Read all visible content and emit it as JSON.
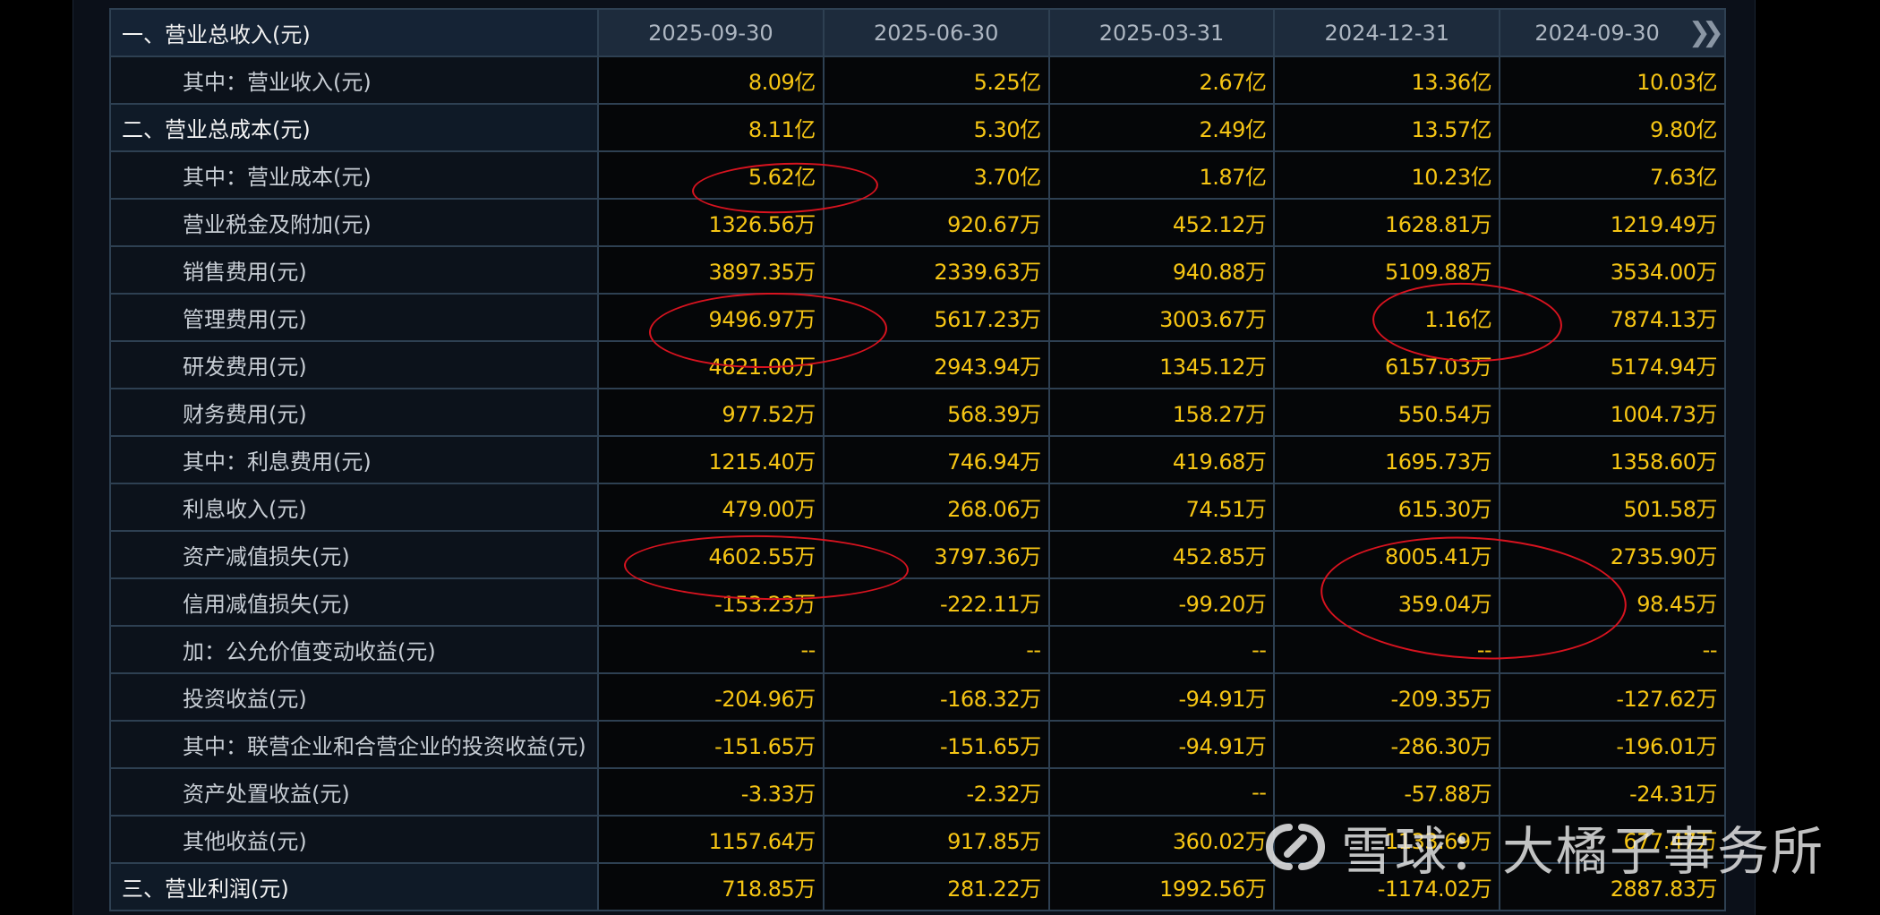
{
  "table": {
    "header_label": "一、营业总收入(元)",
    "dates": [
      "2025-09-30",
      "2025-06-30",
      "2025-03-31",
      "2024-12-31",
      "2024-09-30"
    ],
    "more_icon": "double-chevron-right-icon",
    "rows": [
      {
        "label": "其中：营业收入(元)",
        "indent": "sub",
        "values": [
          "8.09亿",
          "5.25亿",
          "2.67亿",
          "13.36亿",
          "10.03亿"
        ]
      },
      {
        "label": "二、营业总成本(元)",
        "indent": "top",
        "values": [
          "8.11亿",
          "5.30亿",
          "2.49亿",
          "13.57亿",
          "9.80亿"
        ]
      },
      {
        "label": "其中：营业成本(元)",
        "indent": "sub",
        "values": [
          "5.62亿",
          "3.70亿",
          "1.87亿",
          "10.23亿",
          "7.63亿"
        ]
      },
      {
        "label": "营业税金及附加(元)",
        "indent": "sub",
        "values": [
          "1326.56万",
          "920.67万",
          "452.12万",
          "1628.81万",
          "1219.49万"
        ]
      },
      {
        "label": "销售费用(元)",
        "indent": "sub",
        "values": [
          "3897.35万",
          "2339.63万",
          "940.88万",
          "5109.88万",
          "3534.00万"
        ]
      },
      {
        "label": "管理费用(元)",
        "indent": "sub",
        "values": [
          "9496.97万",
          "5617.23万",
          "3003.67万",
          "1.16亿",
          "7874.13万"
        ]
      },
      {
        "label": "研发费用(元)",
        "indent": "sub",
        "values": [
          "4821.00万",
          "2943.94万",
          "1345.12万",
          "6157.03万",
          "5174.94万"
        ]
      },
      {
        "label": "财务费用(元)",
        "indent": "sub",
        "values": [
          "977.52万",
          "568.39万",
          "158.27万",
          "550.54万",
          "1004.73万"
        ]
      },
      {
        "label": "其中：利息费用(元)",
        "indent": "sub",
        "values": [
          "1215.40万",
          "746.94万",
          "419.68万",
          "1695.73万",
          "1358.60万"
        ]
      },
      {
        "label": "利息收入(元)",
        "indent": "sub",
        "values": [
          "479.00万",
          "268.06万",
          "74.51万",
          "615.30万",
          "501.58万"
        ]
      },
      {
        "label": "资产减值损失(元)",
        "indent": "sub",
        "values": [
          "4602.55万",
          "3797.36万",
          "452.85万",
          "8005.41万",
          "2735.90万"
        ]
      },
      {
        "label": "信用减值损失(元)",
        "indent": "sub",
        "values": [
          "-153.23万",
          "-222.11万",
          "-99.20万",
          "359.04万",
          "98.45万"
        ]
      },
      {
        "label": "加：公允价值变动收益(元)",
        "indent": "sub",
        "values": [
          "--",
          "--",
          "--",
          "--",
          "--"
        ]
      },
      {
        "label": "投资收益(元)",
        "indent": "sub",
        "values": [
          "-204.96万",
          "-168.32万",
          "-94.91万",
          "-209.35万",
          "-127.62万"
        ]
      },
      {
        "label": "其中：联营企业和合营企业的投资收益(元)",
        "indent": "sub",
        "values": [
          "-151.65万",
          "-151.65万",
          "-94.91万",
          "-286.30万",
          "-196.01万"
        ]
      },
      {
        "label": "资产处置收益(元)",
        "indent": "sub",
        "values": [
          "-3.33万",
          "-2.32万",
          "--",
          "-57.88万",
          "-24.31万"
        ]
      },
      {
        "label": "其他收益(元)",
        "indent": "sub",
        "values": [
          "1157.64万",
          "917.85万",
          "360.02万",
          "1133.69万",
          "677.47万"
        ]
      },
      {
        "label": "三、营业利润(元)",
        "indent": "top",
        "values": [
          "718.85万",
          "281.22万",
          "1992.56万",
          "-1174.02万",
          "2887.83万"
        ]
      }
    ]
  },
  "watermark": {
    "text": "雪球：大橘子事务所",
    "icon": "xueqiu-logo-icon"
  },
  "colors": {
    "value_text": "#f6c514",
    "annotation_circle": "#d8131f",
    "grid_border": "#2e4052"
  }
}
